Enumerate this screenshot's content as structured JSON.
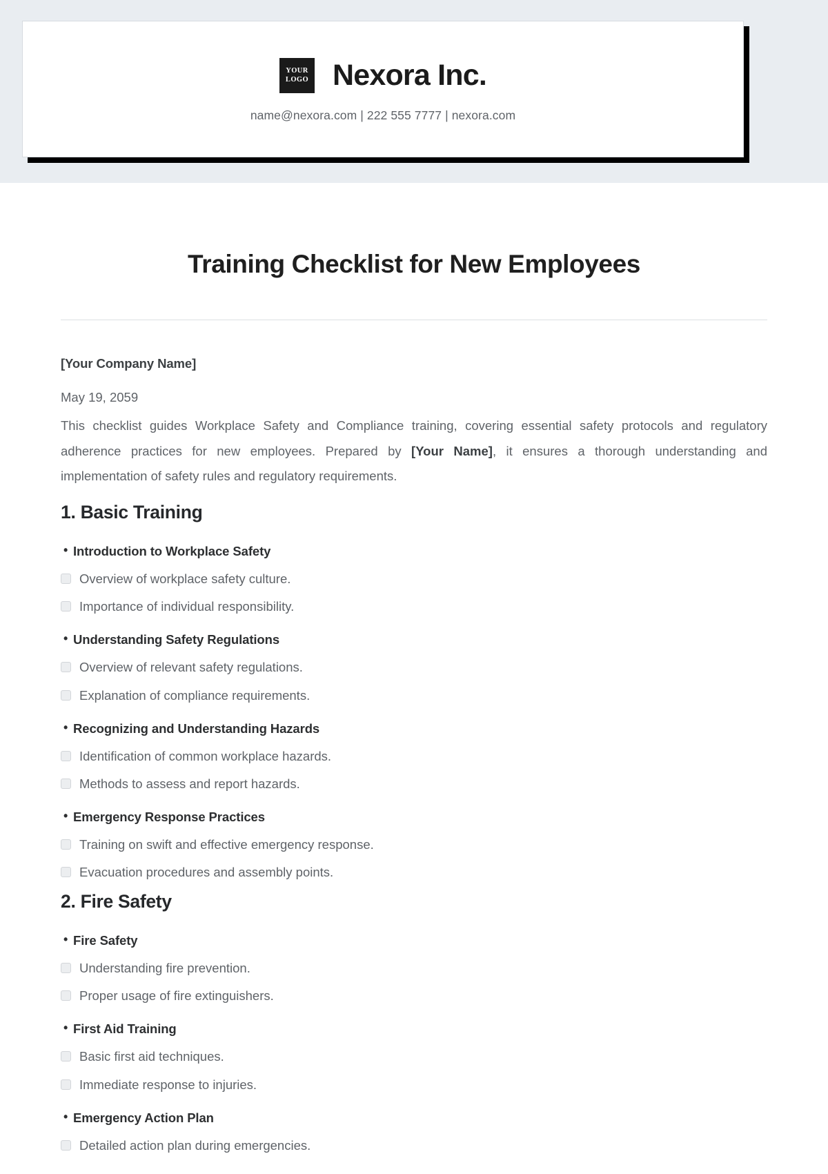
{
  "letterhead": {
    "logo_line1": "YOUR",
    "logo_line2": "LOGO",
    "brand_name": "Nexora Inc.",
    "contact": "name@nexora.com | 222 555 7777 | nexora.com",
    "band_color": "#e9edf1",
    "logo_bg": "#1a1a1a"
  },
  "document": {
    "title": "Training Checklist for New Employees",
    "company": "[Your Company Name]",
    "date": "May 19, 2059",
    "intro_part1": "This checklist guides Workplace Safety and Compliance training, covering essential safety protocols and regulatory adherence practices for new employees. Prepared by ",
    "intro_bold": "[Your Name]",
    "intro_part2": ", it ensures a thorough understanding and implementation of safety rules and regulatory requirements."
  },
  "sections": [
    {
      "heading": "1. Basic Training",
      "groups": [
        {
          "title": "Introduction to Workplace Safety",
          "items": [
            "Overview of workplace safety culture.",
            "Importance of individual responsibility."
          ]
        },
        {
          "title": "Understanding Safety Regulations",
          "items": [
            "Overview of relevant safety regulations.",
            "Explanation of compliance requirements."
          ]
        },
        {
          "title": "Recognizing and Understanding Hazards",
          "items": [
            "Identification of common workplace hazards.",
            "Methods to assess and report hazards."
          ]
        },
        {
          "title": "Emergency Response Practices",
          "items": [
            "Training on swift and effective emergency response.",
            "Evacuation procedures and assembly points."
          ]
        }
      ]
    },
    {
      "heading": "2. Fire Safety",
      "groups": [
        {
          "title": "Fire Safety",
          "items": [
            "Understanding fire prevention.",
            "Proper usage of fire extinguishers."
          ]
        },
        {
          "title": "First Aid Training",
          "items": [
            "Basic first aid techniques.",
            "Immediate response to injuries."
          ]
        },
        {
          "title": "Emergency Action Plan",
          "items": [
            "Detailed action plan during emergencies."
          ]
        }
      ]
    }
  ]
}
